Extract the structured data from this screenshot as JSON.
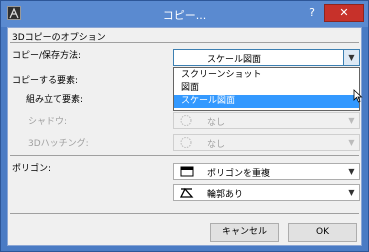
{
  "window": {
    "title": "コピー...",
    "help_glyph": "?",
    "close_glyph": "✕"
  },
  "section": {
    "title": "3Dコピーのオプション"
  },
  "copy_method": {
    "label": "コピー/保存方法:",
    "value": "スケール図面",
    "options": [
      "スクリーンショット",
      "図面",
      "スケール図面"
    ],
    "selected_index": 2
  },
  "elements": {
    "label": "コピーする要素:",
    "assembly_label": "組み立て要素:",
    "shadow": {
      "label": "シャドウ:",
      "value": "なし"
    },
    "hatching": {
      "label": "3Dハッチング:",
      "value": "なし"
    }
  },
  "polygon": {
    "label": "ポリゴン:",
    "fill_value": "ポリゴンを重複",
    "outline_value": "輪郭あり"
  },
  "buttons": {
    "cancel": "キャンセル",
    "ok": "OK"
  },
  "colors": {
    "title_bar": "#5a8ad0",
    "close_button": "#c7312a",
    "selection": "#3399ff",
    "dialog_bg": "#f0f0f0"
  }
}
